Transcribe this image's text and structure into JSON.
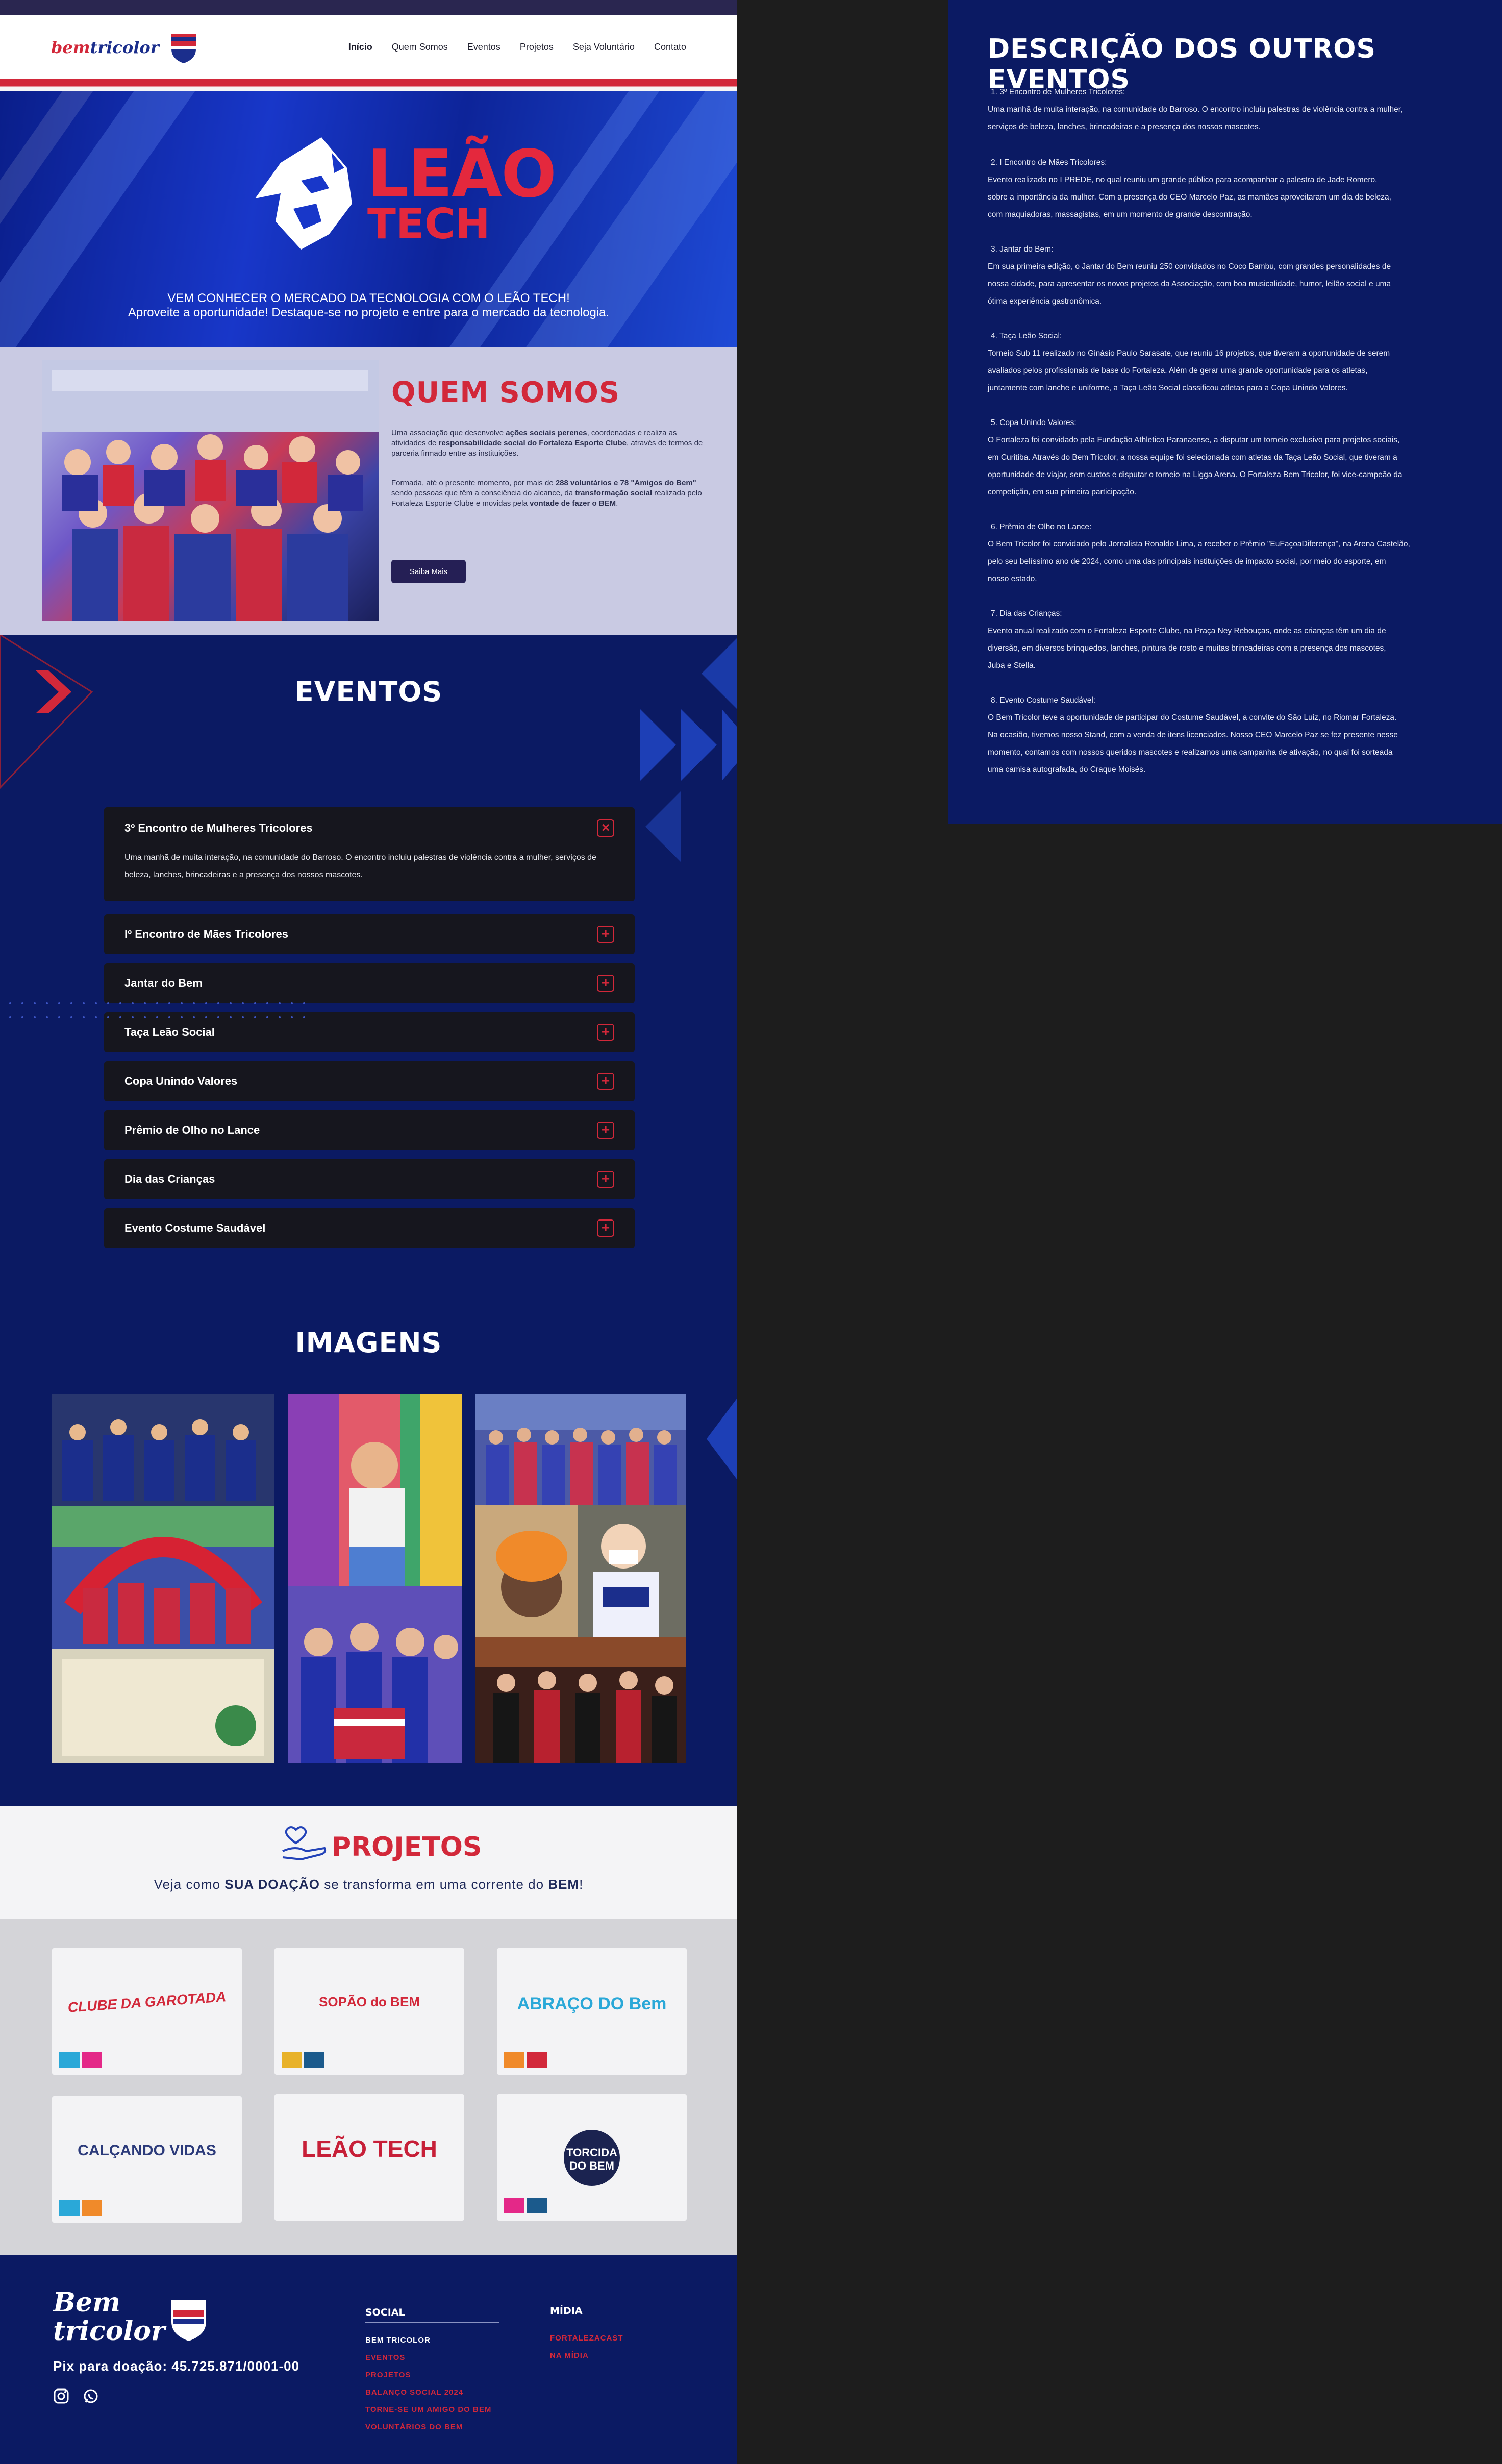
{
  "header": {
    "logo_text_a": "bem",
    "logo_text_b": "tricolor",
    "nav": [
      "Início",
      "Quem Somos",
      "Eventos",
      "Projetos",
      "Seja Voluntário",
      "Contato"
    ]
  },
  "hero": {
    "title_line1": "LEÃO",
    "title_line2": "TECH",
    "sub_line1": "VEM CONHECER O MERCADO DA TECNOLOGIA COM O LEÃO TECH!",
    "sub_line2": "Aproveite a oportunidade! Destaque-se no projeto e entre para o mercado da tecnologia."
  },
  "quem_somos": {
    "title": "QUEM SOMOS",
    "p1_a": "Uma associação que desenvolve ",
    "p1_b": "ações sociais perenes",
    "p1_c": ", coordenadas e realiza as atividades de ",
    "p1_d": "responsabilidade social do Fortaleza Esporte Clube",
    "p1_e": ", através de termos de parceria firmado entre as instituições.",
    "p2_a": "Formada, até o presente momento, por mais de ",
    "p2_b": "288 voluntários e 78 \"Amigos do Bem\"",
    "p2_c": " sendo pessoas que têm a consciência do alcance, da ",
    "p2_d": "transformação social",
    "p2_e": " realizada pelo Fortaleza Esporte Clube e movidas pela ",
    "p2_f": "vontade de fazer o BEM",
    "p2_g": ".",
    "button": "Saiba Mais"
  },
  "eventos": {
    "title": "EVENTOS",
    "open_item": {
      "label": "3º Encontro de Mulheres Tricolores",
      "body": "Uma manhã de muita interação, na comunidade do Barroso. O encontro incluiu palestras de violência contra a mulher, serviços de beleza, lanches, brincadeiras e a presença dos nossos mascotes."
    },
    "items": [
      "Iº Encontro de Mães Tricolores",
      "Jantar do Bem",
      "Taça Leão Social",
      "Copa Unindo Valores",
      "Prêmio de Olho no Lance",
      "Dia das Crianças",
      "Evento Costume Saudável"
    ]
  },
  "imagens": {
    "title": "IMAGENS"
  },
  "projetos": {
    "title": "PROJETOS",
    "sub_a": "Veja como ",
    "sub_b": "SUA DOAÇÃO",
    "sub_c": " se transforma em uma corrente do ",
    "sub_d": "BEM",
    "sub_e": "!",
    "cards": [
      {
        "logo": "CLUBE DA GAROTADA"
      },
      {
        "logo": "SOPÃO do BEM"
      },
      {
        "logo": "ABRAÇO DO Bem"
      },
      {
        "logo": "CALÇANDO VIDAS"
      },
      {
        "logo": "LEÃO TECH"
      },
      {
        "logo": "TORCIDA DO BEM"
      }
    ]
  },
  "footer": {
    "logo_line1": "Bem",
    "logo_line2": "tricolor",
    "pix": "Pix para doação: 45.725.871/0001-00",
    "social_title": "SOCIAL",
    "social_links": [
      "BEM TRICOLOR",
      "EVENTOS",
      "PROJETOS",
      "BALANÇO SOCIAL 2024",
      "TORNE-SE UM AMIGO DO BEM",
      "VOLUNTÁRIOS DO BEM"
    ],
    "midia_title": "MÍDIA",
    "midia_links": [
      "FORTALEZACAST",
      "NA MÍDIA"
    ]
  },
  "descricao": {
    "title": "DESCRIÇÃO DOS OUTROS EVENTOS",
    "blocks": [
      {
        "head": "1. 3º Encontro de Mulheres Tricolores:",
        "lines": [
          "Uma manhã de muita interação, na comunidade do Barroso. O encontro incluiu palestras de violência contra a mulher,",
          "serviços de beleza, lanches, brincadeiras e a presença dos nossos mascotes."
        ]
      },
      {
        "head": "2. I Encontro de Mães Tricolores:",
        "lines": [
          "Evento realizado no I PREDE, no qual reuniu um grande público para acompanhar a palestra de Jade Romero,",
          "sobre a importância da mulher. Com a presença do CEO Marcelo Paz, as mamães aproveitaram um dia de beleza,",
          "com maquiadoras, massagistas, em um momento de grande descontração."
        ]
      },
      {
        "head": "3. Jantar do Bem:",
        "lines": [
          "Em sua primeira edição, o Jantar do Bem reuniu 250 convidados no Coco Bambu, com grandes personalidades de",
          "nossa cidade, para apresentar os novos projetos da Associação, com boa musicalidade, humor, leilão social e uma",
          "ótima experiência gastronômica."
        ]
      },
      {
        "head": "4. Taça Leão Social:",
        "lines": [
          "Torneio Sub 11 realizado no Ginásio Paulo Sarasate, que reuniu 16 projetos, que tiveram a oportunidade de serem",
          "avaliados pelos profissionais de base do Fortaleza. Além de gerar uma grande oportunidade para os atletas,",
          "juntamente com lanche e uniforme, a Taça Leão Social classificou atletas para a Copa Unindo Valores."
        ]
      },
      {
        "head": "5. Copa Unindo Valores:",
        "lines": [
          "O Fortaleza foi convidado pela Fundação Athletico Paranaense, a disputar um torneio exclusivo para projetos sociais,",
          "em Curitiba. Através do Bem Tricolor, a nossa equipe foi selecionada com atletas da Taça Leão Social, que tiveram a",
          "oportunidade de viajar, sem custos e disputar o torneio na Ligga Arena. O Fortaleza Bem Tricolor, foi vice-campeão da",
          "competição, em sua primeira participação."
        ]
      },
      {
        "head": "6. Prêmio de Olho no Lance:",
        "lines": [
          "O Bem Tricolor foi convidado pelo Jornalista Ronaldo Lima, a receber o Prêmio \"EuFaçoaDiferença\", na Arena Castelão,",
          "pelo seu belíssimo ano de 2024, como uma das principais instituições de impacto social, por meio do esporte, em",
          "nosso estado."
        ]
      },
      {
        "head": "7. Dia das Crianças:",
        "lines": [
          "Evento anual realizado com o Fortaleza Esporte Clube, na Praça Ney Rebouças, onde as crianças têm um dia de",
          "diversão, em diversos brinquedos, lanches, pintura de rosto e muitas brincadeiras com a presença dos mascotes,",
          "Juba e Stella."
        ]
      },
      {
        "head": "8. Evento Costume Saudável:",
        "lines": [
          "O Bem Tricolor teve a oportunidade de participar do Costume Saudável, a convite do São Luiz, no Riomar Fortaleza.",
          "Na ocasião, tivemos nosso Stand, com a venda de itens licenciados. Nosso CEO Marcelo Paz se fez presente nesse",
          "momento, contamos com nossos queridos mascotes e realizamos uma campanha de ativação, no qual foi sorteada",
          "uma camisa autografada, do Craque Moisés."
        ]
      }
    ]
  },
  "colors": {
    "navy": "#0b1a63",
    "red": "#d2283a",
    "blue": "#1837c9"
  }
}
